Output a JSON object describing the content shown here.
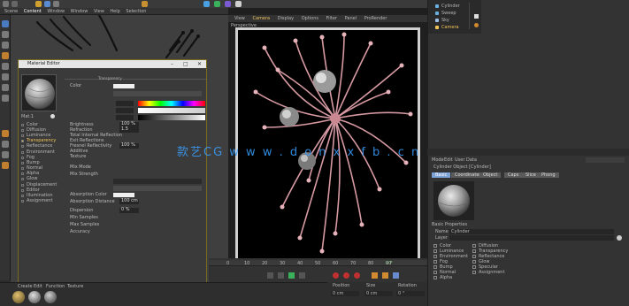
{
  "top_menu": [
    "Scene",
    "Content",
    "Window",
    "Window",
    "View",
    "Help",
    "Selection"
  ],
  "material_editor": {
    "title": "Material Editor",
    "material_name": "Mat.1",
    "channels": [
      {
        "label": "Color",
        "active": false
      },
      {
        "label": "Diffusion",
        "active": false
      },
      {
        "label": "Luminance",
        "active": false
      },
      {
        "label": "Transparency",
        "active": true
      },
      {
        "label": "Reflectance",
        "active": false
      },
      {
        "label": "Environment",
        "active": false
      },
      {
        "label": "Fog",
        "active": false
      },
      {
        "label": "Bump",
        "active": false
      },
      {
        "label": "Normal",
        "active": false
      },
      {
        "label": "Alpha",
        "active": false
      },
      {
        "label": "Glow",
        "active": false
      },
      {
        "label": "Displacement",
        "active": false
      },
      {
        "label": "Editor",
        "active": false
      },
      {
        "label": "Illumination",
        "active": false
      },
      {
        "label": "Assignment",
        "active": false
      }
    ],
    "section_title": "Transparency",
    "params": [
      {
        "label": "Color",
        "value": ""
      },
      {
        "label": "Brightness",
        "value": "100 %"
      },
      {
        "label": "Refraction",
        "value": "1.5"
      },
      {
        "label": "Total Internal Reflection",
        "value": ""
      },
      {
        "label": "Exit Reflections",
        "value": ""
      },
      {
        "label": "Fresnel Reflectivity",
        "value": "100 %"
      },
      {
        "label": "Additive",
        "value": ""
      },
      {
        "label": "Texture",
        "value": ""
      },
      {
        "label": "Mix Mode",
        "value": ""
      },
      {
        "label": "Mix Strength",
        "value": ""
      },
      {
        "label": "Absorption Color",
        "value": ""
      },
      {
        "label": "Absorption Distance",
        "value": "100 cm"
      },
      {
        "label": "Dispersion",
        "value": "0 %"
      },
      {
        "label": "Min Samples",
        "value": ""
      },
      {
        "label": "Max Samples",
        "value": ""
      },
      {
        "label": "Accuracy",
        "value": ""
      }
    ]
  },
  "render_view": {
    "menu": [
      "View",
      "Camera",
      "Display",
      "Options",
      "Filter",
      "Panel",
      "ProRender"
    ],
    "label": "Perspective"
  },
  "timeline": {
    "ticks": [
      "0",
      "10",
      "20",
      "30",
      "40",
      "50",
      "60",
      "70",
      "80",
      "90"
    ],
    "frame_display": "0 F",
    "bottom_labels": [
      "Create",
      "Edit",
      "Function",
      "Texture"
    ],
    "coord_headers": [
      "Position",
      "Size",
      "Rotation"
    ],
    "coord_values": [
      "0 cm",
      "0 cm",
      "0 °"
    ]
  },
  "object_manager": {
    "objects": [
      {
        "name": "Cylinder",
        "color": "#6ab0e0"
      },
      {
        "name": "Sweep",
        "color": "#6ab0e0"
      },
      {
        "name": "Sky",
        "color": "#9fc0e6"
      },
      {
        "name": "Camera",
        "color": "#f0c35a"
      }
    ]
  },
  "attribute_manager": {
    "menu": [
      "Mode",
      "Edit",
      "User Data"
    ],
    "object_title": "Cylinder Object [Cylinder]",
    "tabs": [
      {
        "label": "Basic",
        "on": true
      },
      {
        "label": "Coordinates",
        "on": false
      },
      {
        "label": "Object",
        "on": false
      },
      {
        "label": "Caps",
        "on": false
      },
      {
        "label": "Slice",
        "on": false
      },
      {
        "label": "Phong",
        "on": false
      }
    ],
    "section": "Basic Properties",
    "name_label": "Name",
    "name_value": "Cylinder",
    "layer_label": "Layer",
    "checks_left": [
      "Color",
      "Luminance",
      "Environment",
      "Fog",
      "Bump",
      "Normal",
      "Alpha"
    ],
    "checks_mid": [
      "Diffusion",
      "Transparency",
      "Reflectance",
      "Glow",
      "Specular",
      "Assignment"
    ]
  },
  "watermark": "款艺CG   w w w . d o n x x f b . c n",
  "colors": {
    "accent_blue": "#7da3d6",
    "active_orange": "#f0c35a",
    "editor_border": "#7a6a20"
  }
}
